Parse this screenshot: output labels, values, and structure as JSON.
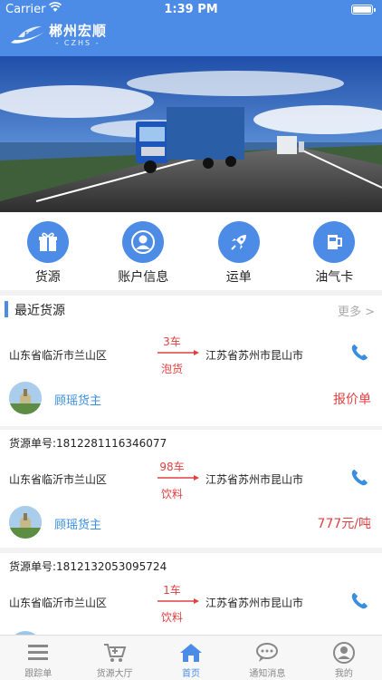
{
  "status": {
    "carrier": "Carrier",
    "time": "1:39 PM"
  },
  "brand": {
    "name": "郴州宏顺",
    "sub": "- CZHS -"
  },
  "menu": [
    {
      "label": "货源",
      "icon": "gift-icon"
    },
    {
      "label": "账户信息",
      "icon": "user-icon"
    },
    {
      "label": "运单",
      "icon": "rocket-icon"
    },
    {
      "label": "油气卡",
      "icon": "fuel-card-icon"
    }
  ],
  "section": {
    "title": "最近货源",
    "more": "更多 >"
  },
  "cards": [
    {
      "order": "",
      "from": "山东省临沂市兰山区",
      "to": "江苏省苏州市昆山市",
      "qty": "3车",
      "goods": "泡货",
      "owner": "顾瑶货主",
      "price": "报价单"
    },
    {
      "order": "货源单号:1812281116346077",
      "from": "山东省临沂市兰山区",
      "to": "江苏省苏州市昆山市",
      "qty": "98车",
      "goods": "饮料",
      "owner": "顾瑶货主",
      "price": "777元/吨"
    },
    {
      "order": "货源单号:1812132053095724",
      "from": "山东省临沂市兰山区",
      "to": "江苏省苏州市昆山市",
      "qty": "1车",
      "goods": "饮料",
      "owner": "",
      "price": ""
    }
  ],
  "tabs": [
    {
      "label": "跟踪单",
      "icon": "list-icon",
      "active": false
    },
    {
      "label": "货源大厅",
      "icon": "cart-icon",
      "active": false
    },
    {
      "label": "首页",
      "icon": "home-icon",
      "active": true
    },
    {
      "label": "通知消息",
      "icon": "chat-icon",
      "active": false
    },
    {
      "label": "我的",
      "icon": "profile-icon",
      "active": false
    }
  ],
  "colors": {
    "primary": "#4d8ce6",
    "accent": "#e04040",
    "link": "#3a8ee0"
  }
}
